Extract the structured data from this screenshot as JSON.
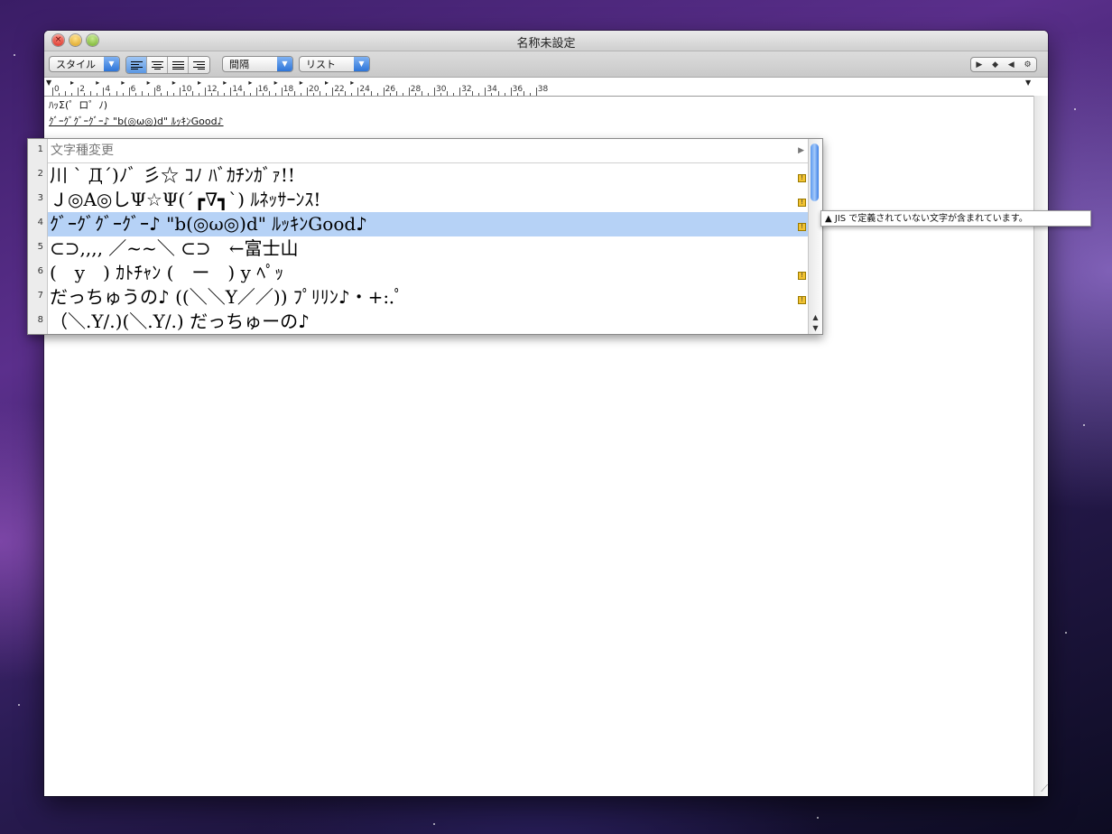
{
  "window": {
    "title": "名称未設定"
  },
  "toolbar": {
    "style_label": "スタイル",
    "spacing_label": "間隔",
    "list_label": "リスト",
    "nav_icons": [
      "▶",
      "◆",
      "◀",
      "⚙"
    ]
  },
  "ruler": {
    "labels": [
      "0",
      "2",
      "4",
      "6",
      "8",
      "10",
      "12",
      "14",
      "16",
      "18",
      "20",
      "22",
      "24",
      "26",
      "28",
      "30",
      "32",
      "34",
      "36",
      "38"
    ]
  },
  "document": {
    "line1": "ﾊｯΣ(゜ロ゜ﾉ)",
    "line2": "ｸﾞｰｸﾞｸﾞｰｸﾞｰ♪ \"b(◎ω◎)d\" ﾙｯｷﾝGood♪"
  },
  "candidates": {
    "header": "文字種変更",
    "items": [
      {
        "num": "2",
        "text": "川 ` Д´)ﾉﾞ 彡☆ ｺﾉ ﾊﾞｶﾁﾝｶﾞｧ!!"
      },
      {
        "num": "3",
        "text": "Ｊ◎A◎しΨ☆Ψ(´┏∇┓`) ﾙﾈｯｻｰﾝｽ!"
      },
      {
        "num": "4",
        "text": "ｸﾞｰｸﾞｸﾞｰｸﾞｰ♪ \"b(◎ω◎)d\" ﾙｯｷﾝGood♪"
      },
      {
        "num": "5",
        "text": "⊂⊃,,,, ／~~＼ ⊂⊃　←富士山"
      },
      {
        "num": "6",
        "text": "(　y　) ｶﾄﾁｬﾝ (　ー　) y ﾍﾟｯ"
      },
      {
        "num": "7",
        "text": "だっちゅうの♪ ((＼＼Y／／)) ﾌﾟﾘﾘﾝ♪・+:.ﾟ"
      },
      {
        "num": "8",
        "text": "（＼.Y/.)(＼.Y/.) だっちゅーの♪"
      }
    ],
    "header_num": "1",
    "warning": "▲ JIS で定義されていない文字が含まれています。"
  },
  "colors": {
    "selection": "#b6d2f6",
    "accent": "#2d74d8"
  }
}
